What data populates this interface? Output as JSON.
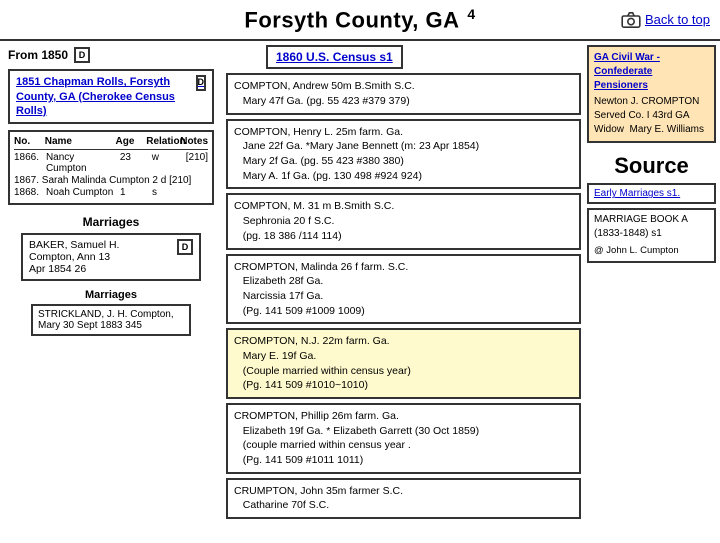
{
  "header": {
    "title": "Forsyth County, GA",
    "title_suffix": "4",
    "back_to_top": "Back to top"
  },
  "left": {
    "from_label": "From 1850",
    "from_icon": "D",
    "chapman_rolls": "1851 Chapman Rolls, Forsyth County, GA (Cherokee Census Rolls)",
    "chapman_icon": "D",
    "census_headers": {
      "no": "No.",
      "name": "Name",
      "age": "Age",
      "relation": "Relation",
      "notes": "Notes"
    },
    "census_rows": [
      {
        "no": "1866.",
        "name": "Nancy Cumpton",
        "age": "23",
        "relation": "w",
        "notes": "[210]"
      },
      {
        "no": "1867.",
        "name": "Sarah Malinda Cumpton",
        "age": "2 d",
        "notes": "[210]"
      },
      {
        "no": "1868.",
        "name": "Noah Cumpton",
        "age": "1",
        "relation": "s",
        "notes": ""
      }
    ],
    "marriages_title": "Marriages",
    "baker_box": "BAKER, Samuel H. Compton, Ann 13 Apr 1854  26",
    "baker_icon": "D",
    "inner_marriages_title": "Marriages",
    "strickland_box": "STRICKLAND, J. H. Compton, Mary 30 Sept 1883 345"
  },
  "census_1860": {
    "header": "1860 U.S. Census  s1"
  },
  "records": [
    {
      "id": "compton_andrew",
      "text": "COMPTON, Andrew  50m  B.Smith S.C.\n   Mary 47f Ga. (pg. 55 423 #379 379)",
      "yellow": false
    },
    {
      "id": "compton_henry",
      "text": "COMPTON, Henry L.  25m farm. Ga.\n   Jane 22f Ga. *Mary Jane Bennett (m: 23 Apr 1854)\n   Mary 2f Ga. (pg. 55 423 #380 380)\n   Mary A. 1f Ga. (pg. 130 498 #924 924)",
      "yellow": false
    },
    {
      "id": "compton_m",
      "text": "COMPTON, M. 31 m B.Smith S.C.\n   Sephronia 20 f S.C.\n   (pg. 18 386 /114 114)",
      "yellow": false
    },
    {
      "id": "crompton_malinda",
      "text": "CROMPTON, Malinda 26 f farm. S.C.\n   Elizabeth 28f Ga.\n   Narcissia 17f Ga.\n   (Pg. 141 509 #1009 1009)",
      "yellow": false
    },
    {
      "id": "crompton_nj",
      "text": "CROMPTON, N.J. 22m farm. Ga.\n   Mary E. 19f Ga.\n   (Couple married within census year)\n   (Pg. 141 509 #1010~1010)",
      "yellow": true
    },
    {
      "id": "crompton_phillip",
      "text": "CROMPTON, Phillip  26m farm. Ga.\n   Elizabeth 19f Ga. * Elizabeth Garrett (30 Oct 1859)\n   (couple married within census year .\n   (Pg. 141 509 #1011 1011)",
      "yellow": false
    },
    {
      "id": "crumpton_john",
      "text": "CRUMPTON, John  35m farmer S.C.\n   Catharine  70f S.C.",
      "yellow": false
    }
  ],
  "far_right": {
    "civil_war_title": "GA Civil War - Confederate Pensioners",
    "civil_war_content": "Newton J. CROMPTON\nServed Co. I 43rd GA\nWidow  Mary E. Williams",
    "source_label": "Source",
    "early_marriages": "Early Marriages s1.",
    "marriage_book_title": "MARRIAGE BOOK A\n(1833-1848) s1",
    "marriage_book_sub": "@ John L. Cumpton"
  }
}
